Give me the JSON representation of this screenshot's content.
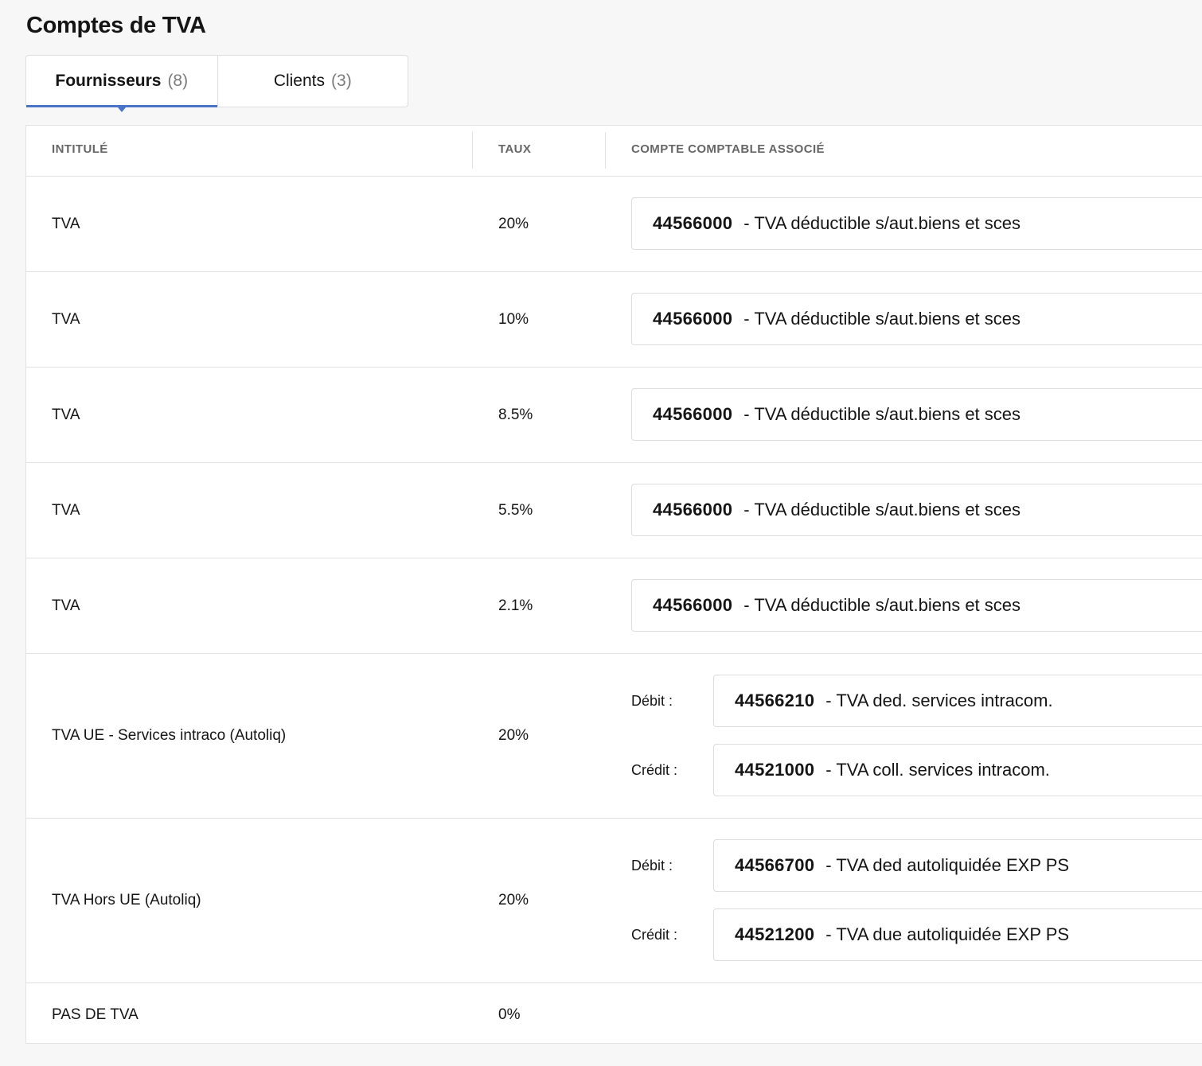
{
  "page": {
    "title": "Comptes de TVA"
  },
  "tabs": [
    {
      "label": "Fournisseurs",
      "count": "(8)",
      "active": true
    },
    {
      "label": "Clients",
      "count": "(3)",
      "active": false
    }
  ],
  "table": {
    "headers": {
      "label": "INTITULÉ",
      "rate": "TAUX",
      "account": "COMPTE COMPTABLE ASSOCIÉ"
    },
    "debit_label": "Débit :",
    "credit_label": "Crédit :",
    "rows": [
      {
        "label": "TVA",
        "rate": "20%",
        "account": {
          "number": "44566000",
          "name": "- TVA déductible s/aut.biens et sces"
        }
      },
      {
        "label": "TVA",
        "rate": "10%",
        "account": {
          "number": "44566000",
          "name": "- TVA déductible s/aut.biens et sces"
        }
      },
      {
        "label": "TVA",
        "rate": "8.5%",
        "account": {
          "number": "44566000",
          "name": "- TVA déductible s/aut.biens et sces"
        }
      },
      {
        "label": "TVA",
        "rate": "5.5%",
        "account": {
          "number": "44566000",
          "name": "- TVA déductible s/aut.biens et sces"
        }
      },
      {
        "label": "TVA",
        "rate": "2.1%",
        "account": {
          "number": "44566000",
          "name": "- TVA déductible s/aut.biens et sces"
        }
      },
      {
        "label": "TVA UE - Services intraco (Autoliq)",
        "rate": "20%",
        "debit": {
          "number": "44566210",
          "name": "- TVA ded. services intracom."
        },
        "credit": {
          "number": "44521000",
          "name": "- TVA coll. services intracom."
        }
      },
      {
        "label": "TVA Hors UE (Autoliq)",
        "rate": "20%",
        "debit": {
          "number": "44566700",
          "name": "- TVA ded autoliquidée EXP PS"
        },
        "credit": {
          "number": "44521200",
          "name": "- TVA due autoliquidée EXP PS"
        }
      },
      {
        "label": "PAS DE TVA",
        "rate": "0%"
      }
    ]
  },
  "colors": {
    "accent": "#4a74c9",
    "background": "#f7f7f7",
    "border": "#e2e2e2"
  }
}
